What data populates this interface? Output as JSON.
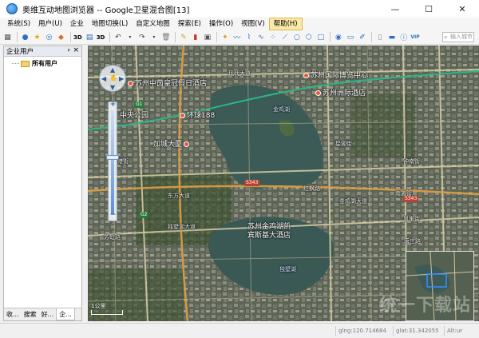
{
  "window": {
    "title": "奥维互动地图浏览器 -- Google卫星混合图[13]",
    "controls": {
      "minimize": "—",
      "maximize": "☐",
      "close": "✕"
    }
  },
  "menu": [
    {
      "label": "系统(S)"
    },
    {
      "label": "用户(U)"
    },
    {
      "label": "企业"
    },
    {
      "label": "地图切换(L)"
    },
    {
      "label": "自定义地图"
    },
    {
      "label": "探索(E)"
    },
    {
      "label": "操作(O)"
    },
    {
      "label": "视图(V)"
    },
    {
      "label": "帮助(H)",
      "active": true
    }
  ],
  "toolbar": {
    "label_3d_a": "3D",
    "label_3d_b": "3D",
    "label_vip": "VIP",
    "search_placeholder": "输入城市"
  },
  "sidebar": {
    "title": "企业用户",
    "pin_icon": "pin-icon",
    "tree_root": "所有用户",
    "tabs": [
      {
        "label": "收..."
      },
      {
        "label": "搜索"
      },
      {
        "label": "好..."
      },
      {
        "label": "企...",
        "selected": true
      }
    ]
  },
  "map": {
    "labels": {
      "hotel1": "苏州中茵皇冠假日酒店",
      "expo": "苏州国际博览中心",
      "hotel2": "苏州洲际酒店",
      "park": "中央公园",
      "huanqiu": "环球188",
      "jinji_lake": "金鸡湖",
      "jiacheng": "加城大厦",
      "hotel3_line1": "苏州金鸡湖凯",
      "hotel3_line2": "宾斯基大酒店",
      "dushu_lake": "独墅湖",
      "road_wuxi": "现代大道",
      "road_xinggang": "星港街",
      "road_xinghu": "星湖街",
      "road_dongfang": "东方大道",
      "road_dushu": "独墅湖大道",
      "road_nanshi": "南施街",
      "road_zhongnan": "钟南街",
      "road_jinji": "金鸡湖大道",
      "road_hongdong": "红枫路",
      "road_jingxian": "凤里街",
      "road_tangzhuang": "唐庄路",
      "road_suhong": "苏虹路",
      "hw_s343a": "S343",
      "hw_s343b": "S343",
      "hw_g1": "G1",
      "hw_g2": "G2"
    },
    "scale_text": "1公里",
    "watermark": "统一下载站"
  },
  "status": {
    "lng": "glng:120.714684",
    "lat": "glat:31.342055",
    "alt": "Alt:ur"
  }
}
